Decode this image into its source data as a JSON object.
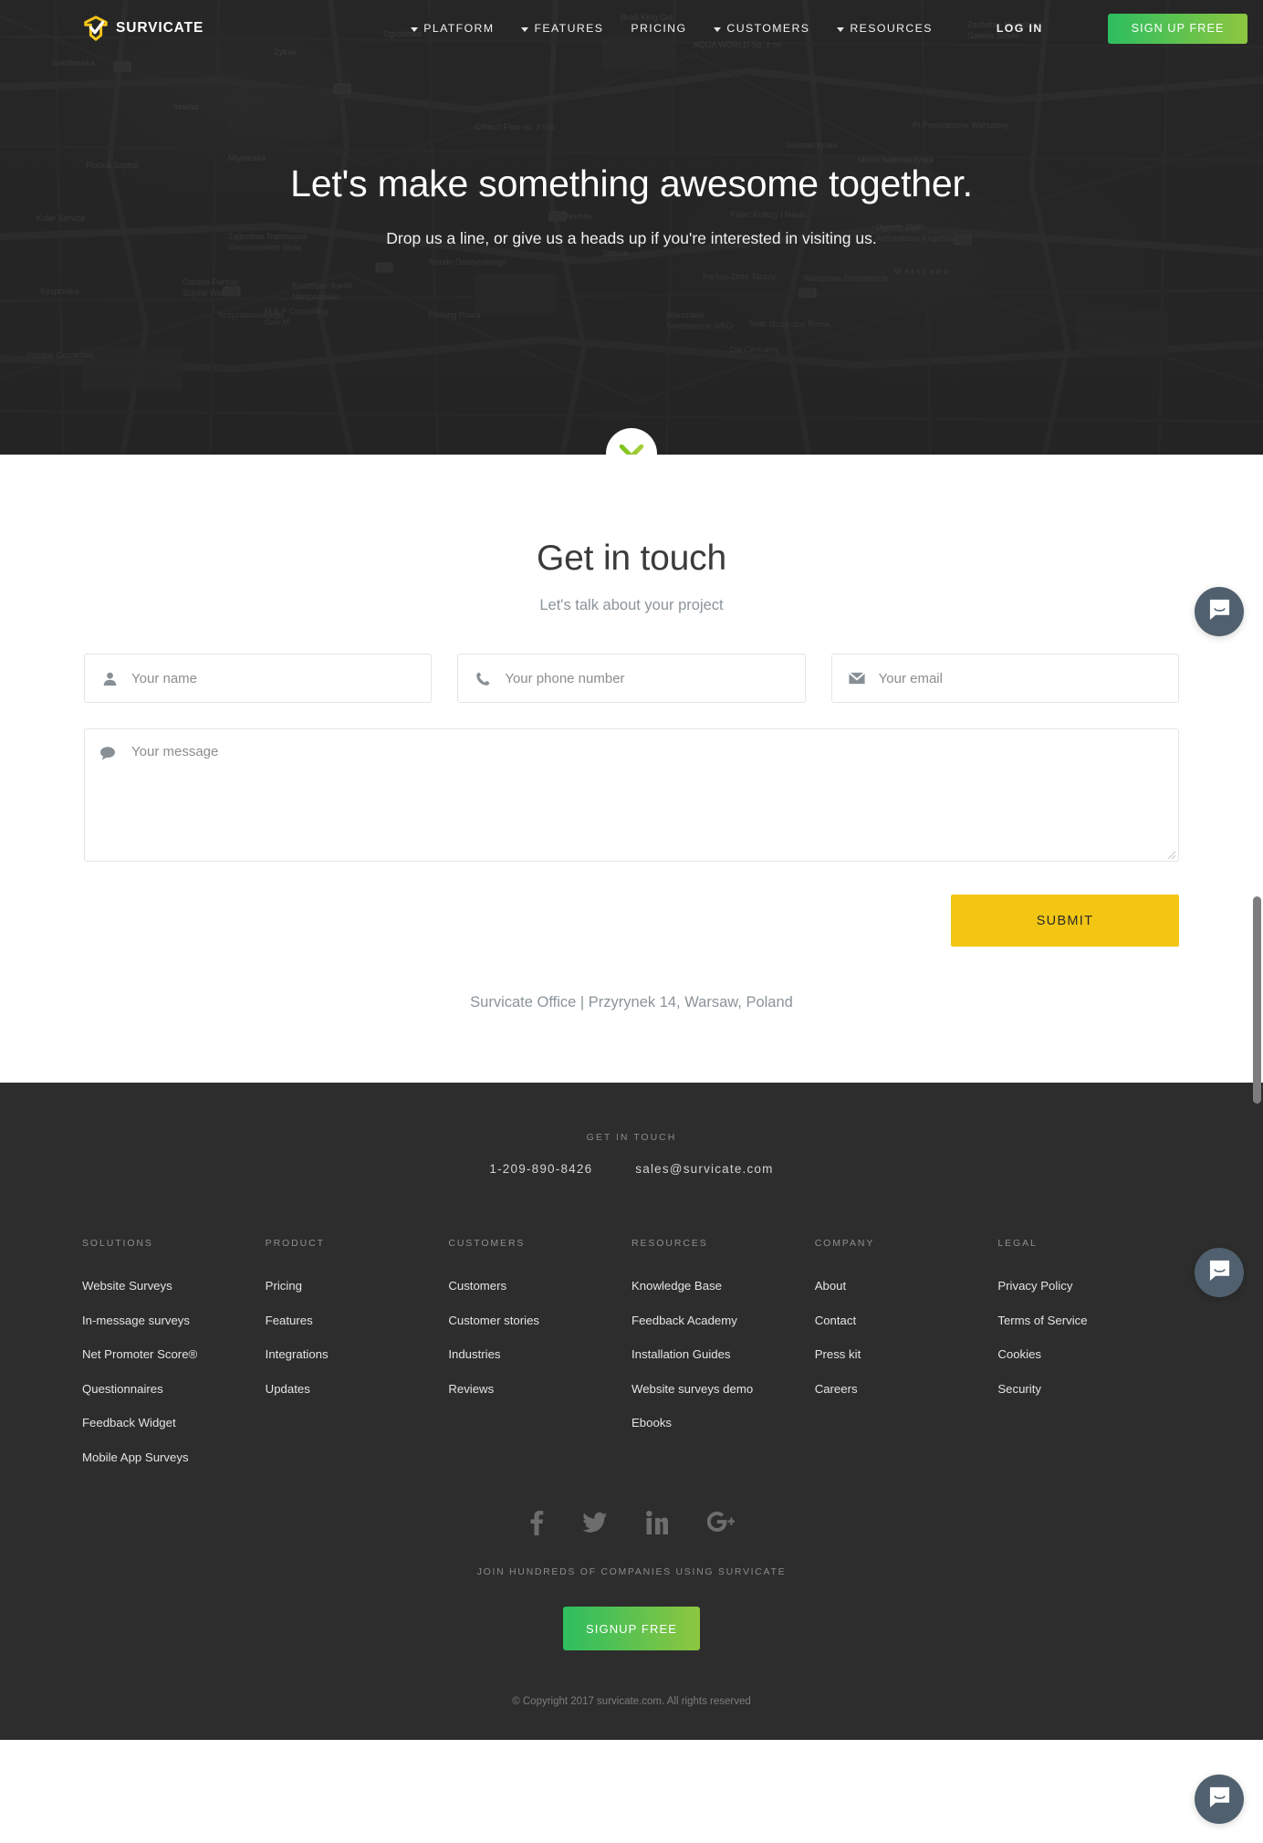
{
  "nav": {
    "brand": "SURVICATE",
    "brand_icon": "survicate-logo-icon",
    "items": [
      {
        "label": "PLATFORM",
        "has_caret": true
      },
      {
        "label": "FEATURES",
        "has_caret": true
      },
      {
        "label": "PRICING",
        "has_caret": false
      },
      {
        "label": "CUSTOMERS",
        "has_caret": true
      },
      {
        "label": "RESOURCES",
        "has_caret": true
      }
    ],
    "login": "LOG IN",
    "signup": "SIGN UP FREE",
    "signup_color_start": "#2dbe60",
    "signup_color_end": "#8dc63f"
  },
  "hero": {
    "title": "Let's make something awesome together.",
    "subtitle": "Drop us a line, or give us a heads up if you're interested in visiting us.",
    "scroll_icon": "chevron-down-icon",
    "background": "map-of-warsaw-dark"
  },
  "contact": {
    "title": "Get in touch",
    "subtitle": "Let's talk about your project",
    "fields": [
      {
        "name": "name",
        "placeholder": "Your name",
        "value": "",
        "icon": "person-icon"
      },
      {
        "name": "phone",
        "placeholder": "Your phone number",
        "value": "",
        "icon": "phone-icon"
      },
      {
        "name": "email",
        "placeholder": "Your email",
        "value": "",
        "icon": "envelope-icon"
      }
    ],
    "message": {
      "placeholder": "Your message",
      "value": "",
      "icon": "speech-bubble-icon"
    },
    "submit": "SUBMIT",
    "submit_color": "#f2c612",
    "office": "Survicate Office | Przyrynek 14, Warsaw, Poland"
  },
  "footer": {
    "get_in_touch_label": "GET IN TOUCH",
    "phone": "1-209-890-8426",
    "email": "sales@survicate.com",
    "columns": [
      {
        "head": "SOLUTIONS",
        "links": [
          "Website Surveys",
          "In-message surveys",
          "Net Promoter Score®",
          "Questionnaires",
          "Feedback Widget",
          "Mobile App Surveys"
        ]
      },
      {
        "head": "PRODUCT",
        "links": [
          "Pricing",
          "Features",
          "Integrations",
          "Updates"
        ]
      },
      {
        "head": "CUSTOMERS",
        "links": [
          "Customers",
          "Customer stories",
          "Industries",
          "Reviews"
        ]
      },
      {
        "head": "RESOURCES",
        "links": [
          "Knowledge Base",
          "Feedback Academy",
          "Installation Guides",
          "Website surveys demo",
          "Ebooks"
        ]
      },
      {
        "head": "COMPANY",
        "links": [
          "About",
          "Contact",
          "Press kit",
          "Careers"
        ]
      },
      {
        "head": "LEGAL",
        "links": [
          "Privacy Policy",
          "Terms of Service",
          "Cookies",
          "Security"
        ]
      }
    ],
    "socials": [
      {
        "name": "facebook-icon"
      },
      {
        "name": "twitter-icon"
      },
      {
        "name": "linkedin-icon"
      },
      {
        "name": "google-plus-icon"
      }
    ],
    "join_line": "JOIN HUNDREDS OF COMPANIES USING SURVICATE",
    "signup": "SIGNUP FREE",
    "copyright": "© Copyright 2017 survicate.com. All rights reserved"
  },
  "widgets": {
    "intercom_label": "chat-bubble-icon",
    "intercom_color": "#51606e"
  }
}
